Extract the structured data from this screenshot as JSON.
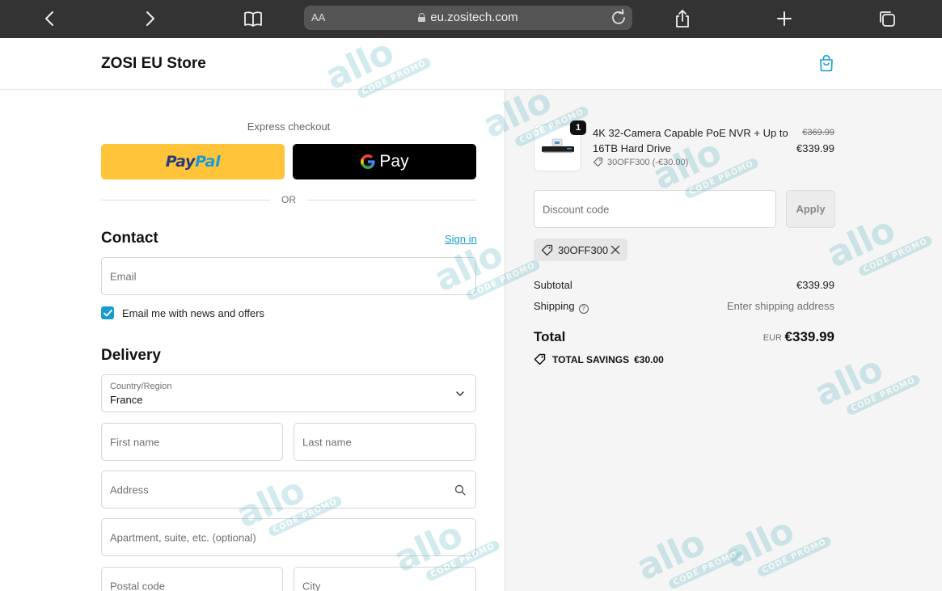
{
  "browser": {
    "aa_label": "AA",
    "url": "eu.zositech.com"
  },
  "header": {
    "store_name": "ZOSI EU Store"
  },
  "express": {
    "label": "Express checkout",
    "paypal_pay": "Pay",
    "paypal_pal": "Pal",
    "gpay_label": "Pay",
    "or_label": "OR"
  },
  "contact": {
    "title": "Contact",
    "sign_in": "Sign in",
    "email_placeholder": "Email",
    "newsletter_label": "Email me with news and offers",
    "newsletter_checked": true
  },
  "delivery": {
    "title": "Delivery",
    "country_label": "Country/Region",
    "country_value": "France",
    "first_name_placeholder": "First name",
    "last_name_placeholder": "Last name",
    "address_placeholder": "Address",
    "apartment_placeholder": "Apartment, suite, etc. (optional)",
    "postal_placeholder": "Postal code",
    "city_placeholder": "City"
  },
  "summary": {
    "product": {
      "quantity": "1",
      "name": "4K 32-Camera Capable PoE NVR + Up to 16TB Hard Drive",
      "discount": "30OFF300 (-€30.00)",
      "price_old": "€369.99",
      "price_new": "€339.99"
    },
    "discount_placeholder": "Discount code",
    "apply_label": "Apply",
    "applied_code": "30OFF300",
    "subtotal_label": "Subtotal",
    "subtotal_value": "€339.99",
    "shipping_label": "Shipping",
    "shipping_value": "Enter shipping address",
    "total_label": "Total",
    "total_currency": "EUR",
    "total_value": "€339.99",
    "savings_label": "TOTAL SAVINGS",
    "savings_value": "€30.00"
  },
  "watermark": {
    "brand": "allo",
    "sub": "CODE PROMO"
  },
  "colors": {
    "accent": "#1a9cd1",
    "paypal_yellow": "#ffc439",
    "browser_bar": "#333333"
  }
}
